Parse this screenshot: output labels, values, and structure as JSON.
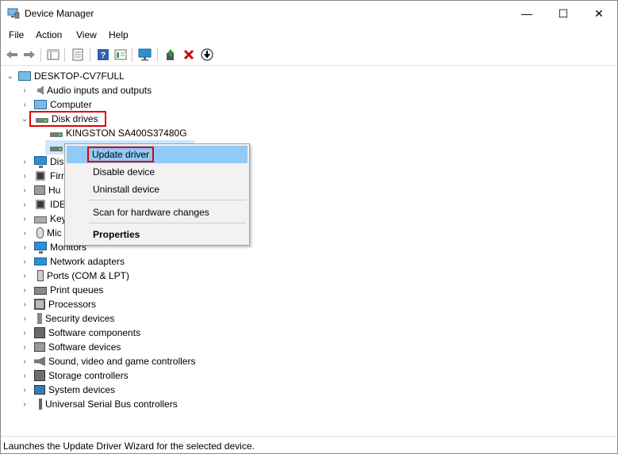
{
  "window": {
    "title": "Device Manager"
  },
  "title_controls": {
    "minimize": "—",
    "maximize": "☐",
    "close": "✕"
  },
  "menu": [
    "File",
    "Action",
    "View",
    "Help"
  ],
  "tree": {
    "root": "DESKTOP-CV7FULL",
    "categories": [
      "Audio inputs and outputs",
      "Computer",
      "Disk drives",
      "Dis",
      "Firm",
      "Hu",
      "IDE",
      "Key",
      "Mic",
      "Monitors",
      "Network adapters",
      "Ports (COM & LPT)",
      "Print queues",
      "Processors",
      "Security devices",
      "Software components",
      "Software devices",
      "Sound, video and game controllers",
      "Storage controllers",
      "System devices",
      "Universal Serial Bus controllers"
    ],
    "disk_children": [
      "KINGSTON SA400S37480G",
      ""
    ]
  },
  "context_menu": {
    "items": [
      "Update driver",
      "Disable device",
      "Uninstall device",
      "Scan for hardware changes",
      "Properties"
    ]
  },
  "status": {
    "text": "Launches the Update Driver Wizard for the selected device."
  },
  "colors": {
    "highlight": "#e00000",
    "menu_hover": "#91c9f7",
    "selection": "#cce8ff"
  }
}
